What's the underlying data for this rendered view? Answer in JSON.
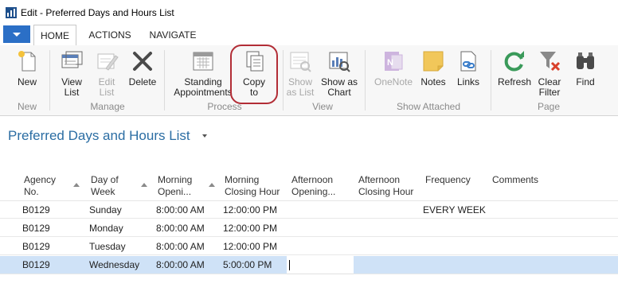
{
  "window": {
    "title": "Edit - Preferred Days and Hours List"
  },
  "tabs": [
    {
      "label": "HOME",
      "active": true
    },
    {
      "label": "ACTIONS",
      "active": false
    },
    {
      "label": "NAVIGATE",
      "active": false
    }
  ],
  "ribbon": {
    "groups": {
      "new": "New",
      "manage": "Manage",
      "process": "Process",
      "view": "View",
      "show_attached": "Show Attached",
      "page": "Page"
    },
    "buttons": {
      "new": "New",
      "view_list": "View\nList",
      "edit_list": "Edit\nList",
      "delete": "Delete",
      "standing_appointments": "Standing\nAppointments",
      "copy_to": "Copy\nto",
      "show_as_list": "Show\nas List",
      "show_as_chart": "Show as\nChart",
      "onenote": "OneNote",
      "notes": "Notes",
      "links": "Links",
      "refresh": "Refresh",
      "clear_filter": "Clear\nFilter",
      "find": "Find"
    }
  },
  "page": {
    "title": "Preferred Days and Hours List"
  },
  "table": {
    "columns": [
      "Agency\nNo.",
      "Day of\nWeek",
      "Morning\nOpeni...",
      "Morning\nClosing Hour",
      "Afternoon\nOpening...",
      "Afternoon\nClosing Hour",
      "Frequency",
      "Comments"
    ],
    "rows": [
      [
        "B0129",
        "Sunday",
        "8:00:00 AM",
        "12:00:00 PM",
        "",
        "",
        "EVERY WEEK",
        ""
      ],
      [
        "B0129",
        "Monday",
        "8:00:00 AM",
        "12:00:00 PM",
        "",
        "",
        "",
        ""
      ],
      [
        "B0129",
        "Tuesday",
        "8:00:00 AM",
        "12:00:00 PM",
        "",
        "",
        "",
        ""
      ],
      [
        "B0129",
        "Wednesday",
        "8:00:00 AM",
        "5:00:00 PM",
        "",
        "",
        "",
        ""
      ]
    ],
    "selected_row": 3
  },
  "colors": {
    "accent": "#2b6fc6",
    "title": "#2b6da3",
    "selection": "#cfe2f7",
    "highlight_ring": "#b22d36"
  }
}
